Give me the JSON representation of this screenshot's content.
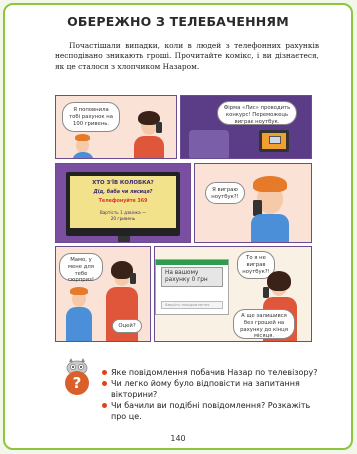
{
  "title": "ОБЕРЕЖНО З ТЕЛЕБАЧЕННЯМ",
  "intro": "Почастішали випадки, коли в людей з телефонних рахунків несподівано зникають гроші. Прочитайте комікс, і ви дізнаєтеся, як це сталося з хлопчиком Назаром.",
  "comic": {
    "p1_bubble": "Я поповнила тобі рахунок на 100 гривень.",
    "p2_bubble": "Фірма «Лис» проводить конкурс! Переможець виграє ноутбук.",
    "tv": {
      "title": "ХТО З'ЇВ КОЛОБКА?",
      "question": "Дід, баба чи лисиця?",
      "phone": "Телефонуйте 369",
      "small1": "Вартість 1 дзвінка —",
      "small2": "20 гривень"
    },
    "p4_bubble": "Я виграю ноутбук?!",
    "p5_bubble": "Мамо, у мене для тебе сюрприз!",
    "p5_reply": "Оцей?",
    "sms": "На вашому рахунку 0 грн",
    "sms_input": "Введіть повідомлення",
    "p6_bubble1": "То я не виграв ноутбук?!",
    "p6_bubble2": "А ще залишився без грошей на рахунку до кінця місяця."
  },
  "questions": [
    "Яке повідомлення побачив Назар по телевізору?",
    "Чи легко йому було відповісти на запитання вікторини?",
    "Чи бачили ви подібні повідомлення? Розкажіть про це."
  ],
  "page_number": "140",
  "colors": {
    "frame": "#8cc63f",
    "panel_purple": "#6b4c8e",
    "bullet": "#e2411a"
  },
  "icons": {
    "question": "question-mark-icon",
    "owl": "owl-icon"
  }
}
